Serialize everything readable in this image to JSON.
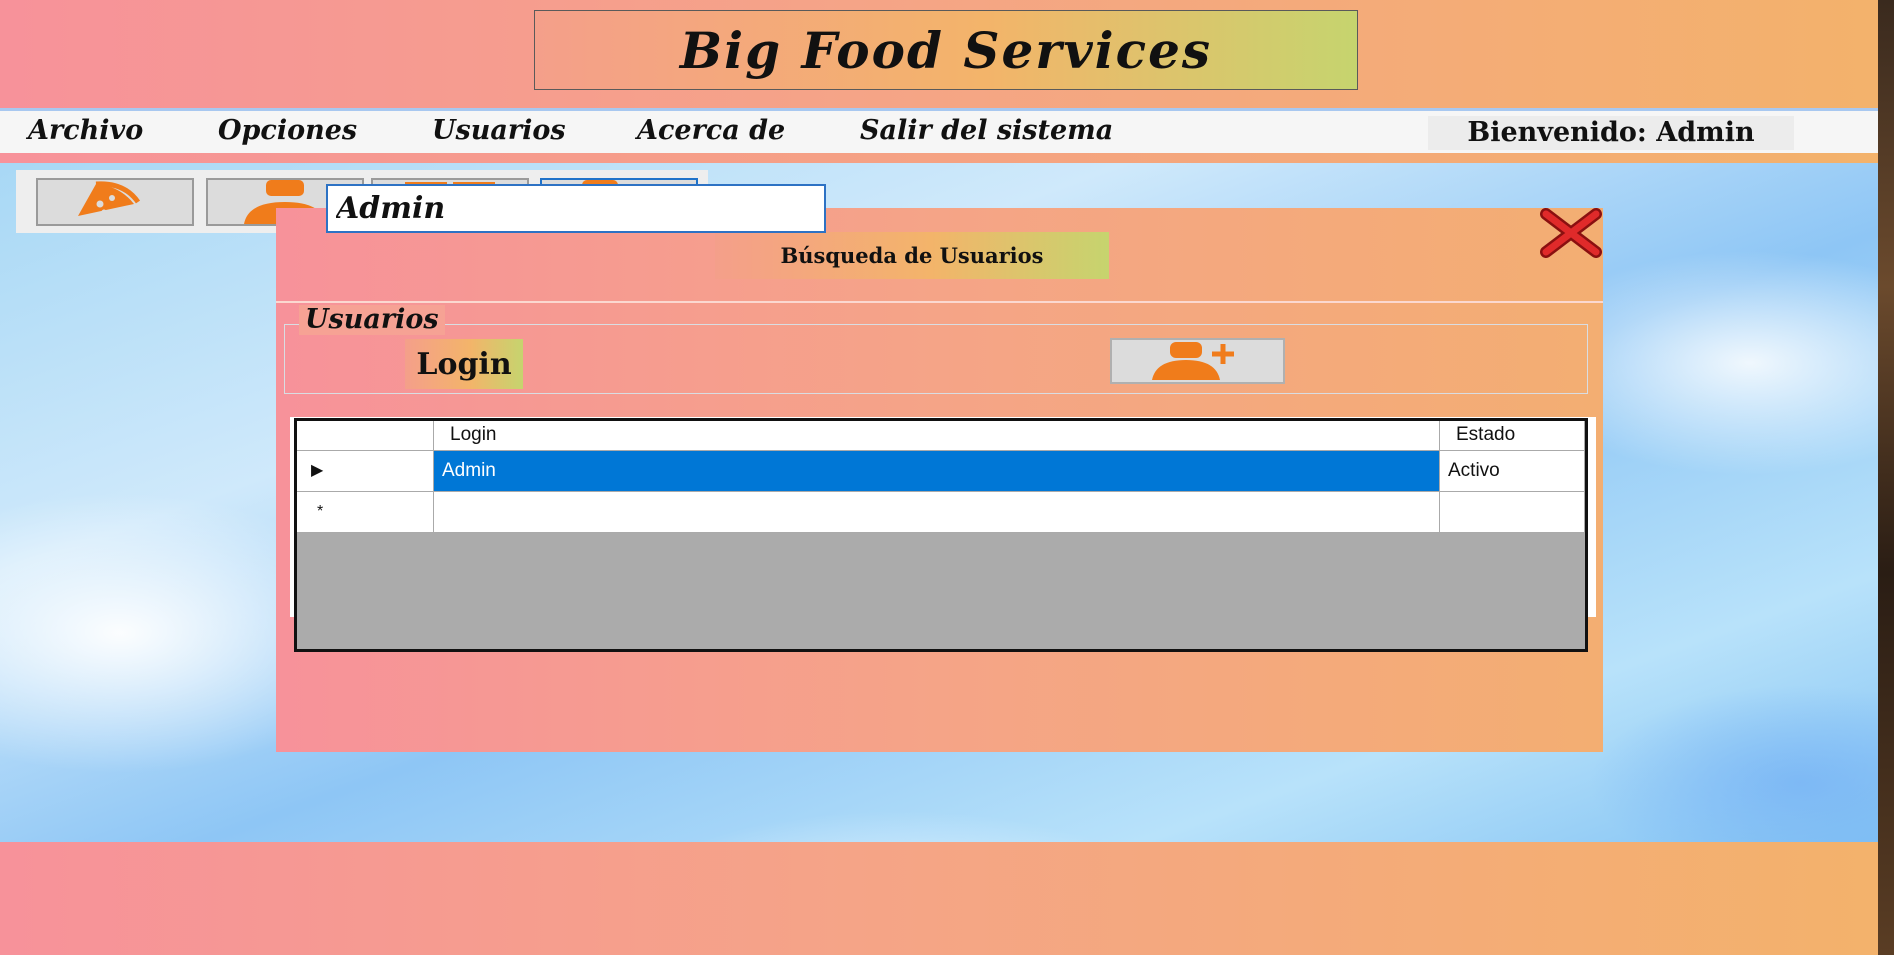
{
  "app": {
    "title": "Big Food Services",
    "welcome": "Bienvenido: Admin"
  },
  "menu": {
    "items": [
      {
        "label": "Archivo"
      },
      {
        "label": "Opciones"
      },
      {
        "label": "Usuarios"
      },
      {
        "label": "Acerca de"
      },
      {
        "label": "Salir del sistema"
      }
    ]
  },
  "toolbar": {
    "buttons": [
      {
        "icon": "pizza-icon"
      },
      {
        "icon": "user-icon"
      },
      {
        "icon": "grid-icon"
      },
      {
        "icon": "user-settings-icon",
        "active": true
      }
    ]
  },
  "dialog": {
    "title": "Búsqueda de Usuarios",
    "group_label": "Usuarios",
    "login_label": "Login",
    "login_value": "Admin",
    "add_user_icon": "user-plus-icon",
    "close_icon": "close-icon"
  },
  "grid": {
    "columns": [
      "Login",
      "Estado"
    ],
    "rows": [
      {
        "login": "Admin",
        "estado": "Activo",
        "selected": true
      }
    ],
    "new_row_marker": "*",
    "current_row_marker": "▶"
  },
  "colors": {
    "accent_blue": "#0077d6",
    "icon_orange": "#f07c1b",
    "gradient_pink": "#f7929a",
    "gradient_orange": "#f3b26b",
    "gradient_green": "#c6d46e"
  }
}
